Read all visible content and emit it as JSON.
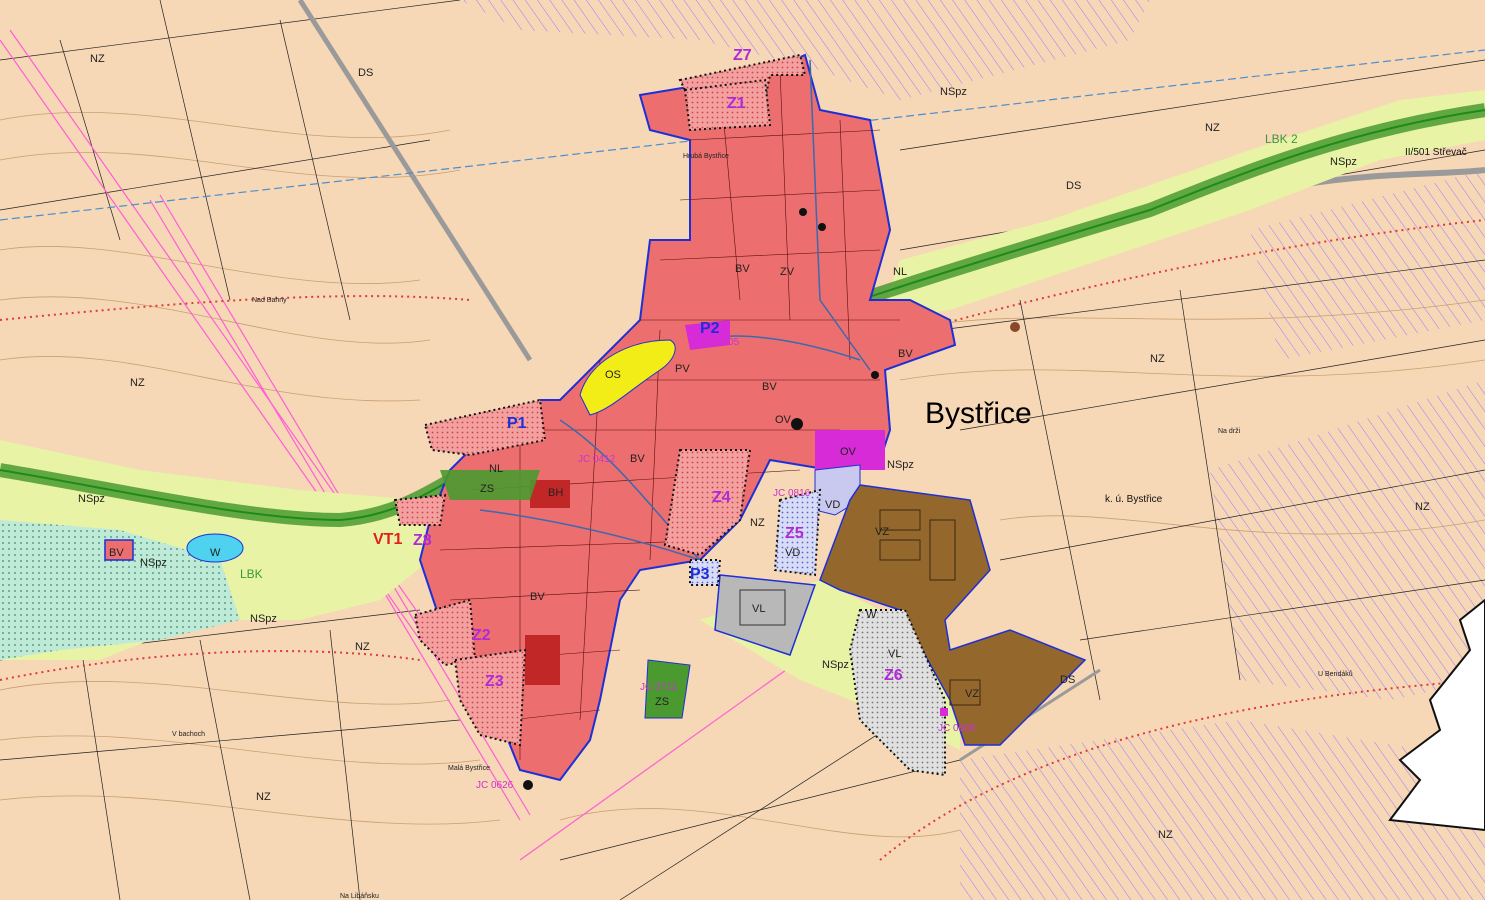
{
  "map": {
    "settlement_name": "Bystřice",
    "cadastre_label": "k. ú. Bystřice",
    "road_label": "II/501 Střevač",
    "corridor_labels": [
      "LBK 2",
      "LBK"
    ],
    "place_names": [
      "Nad Bahny",
      "Na drži",
      "U Bendáků",
      "V bachoch",
      "Malá Bystřice",
      "Na Libáňsku",
      "Hrubá Bystřice"
    ],
    "development_areas": [
      "Z1",
      "Z2",
      "Z3",
      "Z4",
      "Z5",
      "Z6",
      "Z7",
      "Z8"
    ],
    "redevelopment_areas": [
      "P1",
      "P2",
      "P3"
    ],
    "public_works_label": "VT1",
    "land_use_codes": [
      "BV",
      "BH",
      "NZ",
      "NSpz",
      "NL",
      "ZS",
      "ZV",
      "OS",
      "OV",
      "VD",
      "VZ",
      "VL",
      "DS",
      "W",
      "PV"
    ],
    "jc_codes": [
      "JC 0608",
      "JC 0712",
      "JC 0626",
      "JC 0412",
      "JC 0816",
      "JC 0605"
    ],
    "colors": {
      "agricultural_nz": "#f6d7b6",
      "residential_bv": "#ec6e6e",
      "residential_bh": "#c22727",
      "sport_os": "#f2ec17",
      "civic_ov": "#d62bd6",
      "production_vd": "#c9c9f0",
      "agri_production_vz": "#94672c",
      "warehouse_vl": "#b8b8b8",
      "greenery_zs": "#4a9a2f",
      "meadow_nspz": "#e8f3a6",
      "water_w": "#4fd2f0",
      "boundary_blue": "#1d2fd6",
      "label_purple": "#b02ad6"
    }
  }
}
